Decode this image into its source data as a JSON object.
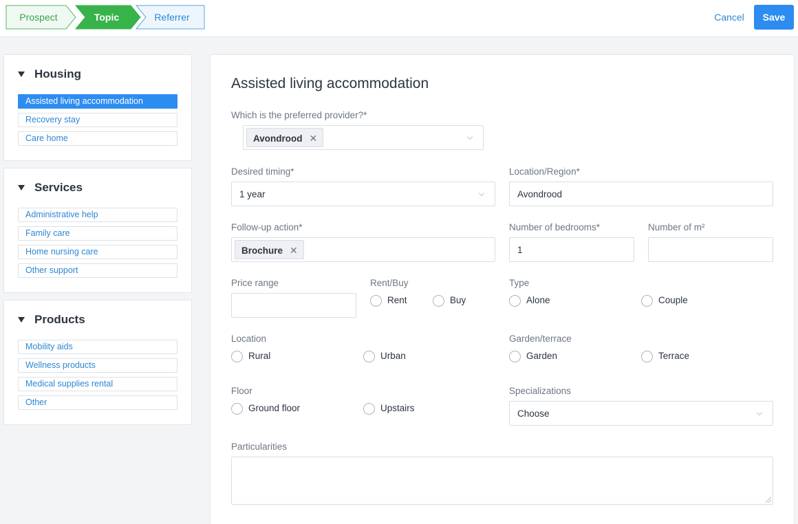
{
  "steps": [
    {
      "label": "Prospect"
    },
    {
      "label": "Topic"
    },
    {
      "label": "Referrer"
    }
  ],
  "actions": {
    "cancel": "Cancel",
    "save": "Save"
  },
  "sidebar": {
    "housing": {
      "title": "Housing",
      "items": [
        "Assisted living accommodation",
        "Recovery stay",
        "Care home"
      ]
    },
    "services": {
      "title": "Services",
      "items": [
        "Administrative help",
        "Family care",
        "Home nursing care",
        "Other support"
      ]
    },
    "products": {
      "title": "Products",
      "items": [
        "Mobility aids",
        "Wellness products",
        "Medical supplies rental",
        "Other"
      ]
    }
  },
  "form": {
    "title": "Assisted living accommodation",
    "provider": {
      "label": "Which is the preferred provider?*",
      "tag": "Avondrood"
    },
    "timing": {
      "label": "Desired timing*",
      "value": "1 year"
    },
    "region": {
      "label": "Location/Region*",
      "value": "Avondrood"
    },
    "followup": {
      "label": "Follow-up action*",
      "tag": "Brochure"
    },
    "bedrooms": {
      "label": "Number of bedrooms*",
      "value": "1"
    },
    "area": {
      "label": "Number of m²",
      "value": ""
    },
    "price": {
      "label": "Price range",
      "value": ""
    },
    "rentbuy": {
      "label": "Rent/Buy",
      "options": [
        "Rent",
        "Buy"
      ]
    },
    "type": {
      "label": "Type",
      "options": [
        "Alone",
        "Couple"
      ]
    },
    "location": {
      "label": "Location",
      "options": [
        "Rural",
        "Urban"
      ]
    },
    "garden": {
      "label": "Garden/terrace",
      "options": [
        "Garden",
        "Terrace"
      ]
    },
    "floor": {
      "label": "Floor",
      "options": [
        "Ground floor",
        "Upstairs"
      ]
    },
    "specializations": {
      "label": "Specializations",
      "value": "Choose"
    },
    "particularities": {
      "label": "Particularities",
      "value": ""
    },
    "tag_remove_glyph": "✕"
  }
}
